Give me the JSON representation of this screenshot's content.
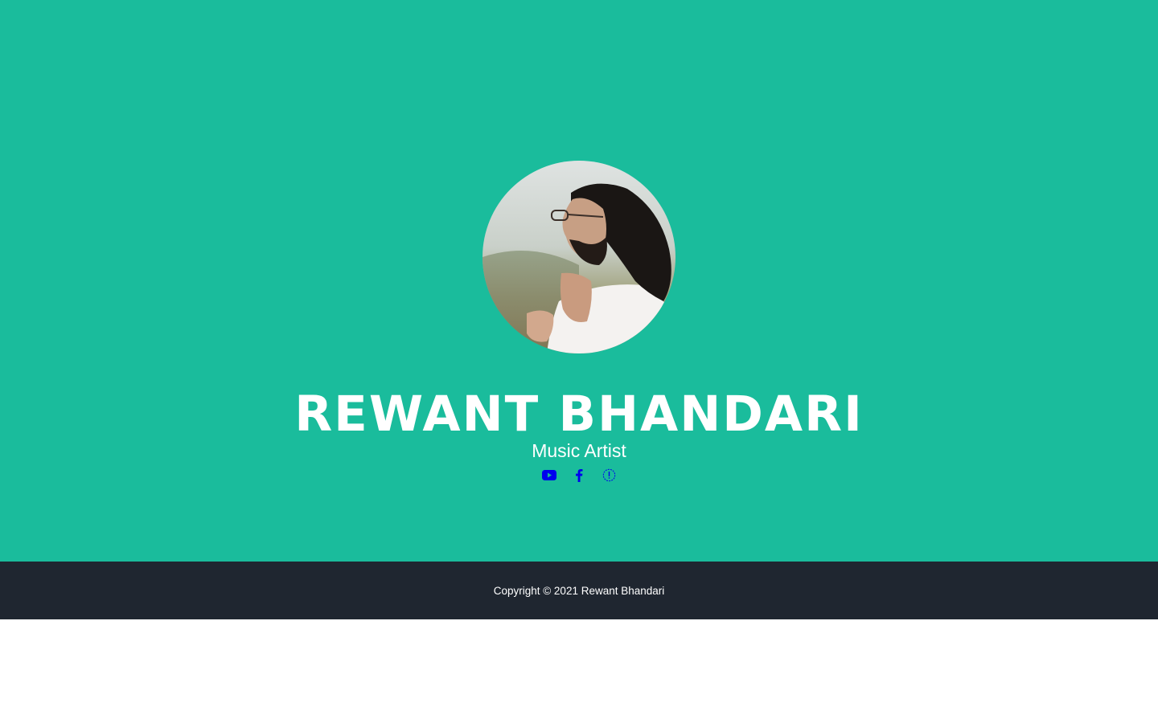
{
  "profile": {
    "name": "REWANT BHANDARI",
    "subtitle": "Music Artist"
  },
  "social": {
    "items": [
      {
        "icon": "youtube-icon"
      },
      {
        "icon": "facebook-icon"
      },
      {
        "icon": "info-icon"
      }
    ],
    "link_color": "#0000ee"
  },
  "footer": {
    "copyright": "Copyright © 2021 Rewant Bhandari"
  },
  "colors": {
    "hero_background": "#1abc9c",
    "footer_background": "#1f2630",
    "text": "#ffffff"
  }
}
